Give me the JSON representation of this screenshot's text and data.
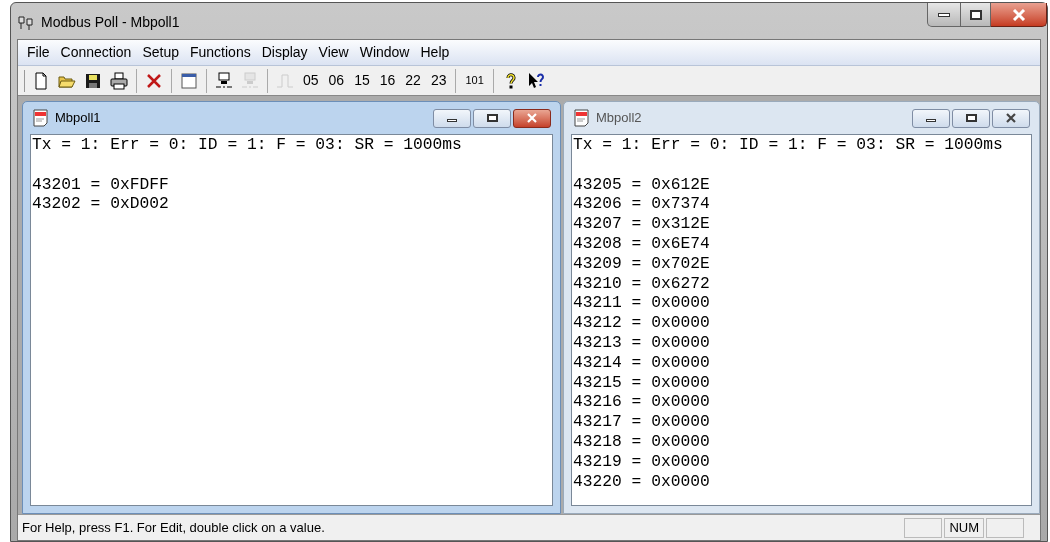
{
  "window": {
    "title": "Modbus Poll - Mbpoll1"
  },
  "menu": [
    "File",
    "Connection",
    "Setup",
    "Functions",
    "Display",
    "View",
    "Window",
    "Help"
  ],
  "toolbar": [
    {
      "kind": "new",
      "disabled": false
    },
    {
      "kind": "open",
      "disabled": false
    },
    {
      "kind": "save",
      "disabled": false
    },
    {
      "kind": "print",
      "disabled": false
    },
    {
      "kind": "sep"
    },
    {
      "kind": "delete",
      "disabled": false
    },
    {
      "kind": "sep"
    },
    {
      "kind": "window",
      "disabled": false
    },
    {
      "kind": "sep"
    },
    {
      "kind": "connect",
      "disabled": false
    },
    {
      "kind": "disconnect",
      "disabled": true
    },
    {
      "kind": "sep"
    },
    {
      "kind": "pulse",
      "disabled": true
    },
    {
      "kind": "text",
      "label": "05",
      "disabled": false
    },
    {
      "kind": "text",
      "label": "06",
      "disabled": false
    },
    {
      "kind": "text",
      "label": "15",
      "disabled": false
    },
    {
      "kind": "text",
      "label": "16",
      "disabled": false
    },
    {
      "kind": "text",
      "label": "22",
      "disabled": false
    },
    {
      "kind": "text",
      "label": "23",
      "disabled": false
    },
    {
      "kind": "sep"
    },
    {
      "kind": "small",
      "label": "101",
      "disabled": false
    },
    {
      "kind": "sep"
    },
    {
      "kind": "help",
      "disabled": false
    },
    {
      "kind": "context-help",
      "disabled": false
    }
  ],
  "documents": [
    {
      "title": "Mbpoll1",
      "active": true,
      "header": "Tx = 1: Err = 0: ID = 1: F = 03: SR = 1000ms",
      "registers": [
        "43201 = 0xFDFF",
        "43202 = 0xD002"
      ]
    },
    {
      "title": "Mbpoll2",
      "active": false,
      "header": "Tx = 1: Err = 0: ID = 1: F = 03: SR = 1000ms",
      "registers": [
        "43205 = 0x612E",
        "43206 = 0x7374",
        "43207 = 0x312E",
        "43208 = 0x6E74",
        "43209 = 0x702E",
        "43210 = 0x6272",
        "43211 = 0x0000",
        "43212 = 0x0000",
        "43213 = 0x0000",
        "43214 = 0x0000",
        "43215 = 0x0000",
        "43216 = 0x0000",
        "43217 = 0x0000",
        "43218 = 0x0000",
        "43219 = 0x0000",
        "43220 = 0x0000"
      ]
    }
  ],
  "status_bar": {
    "text": "For Help, press F1.  For Edit, double click on a value.",
    "indicator": "NUM"
  }
}
